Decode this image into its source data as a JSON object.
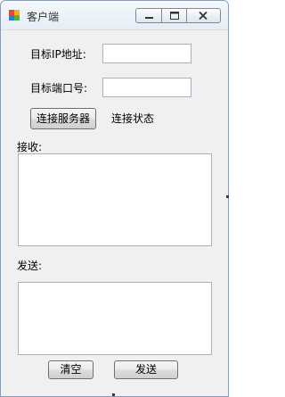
{
  "window": {
    "title": "客户端"
  },
  "form": {
    "target_ip_label": "目标IP地址:",
    "target_ip_value": "",
    "target_port_label": "目标端口号:",
    "target_port_value": "",
    "connect_button": "连接服务器",
    "connection_status": "连接状态",
    "receive_label": "接收:",
    "receive_value": "",
    "send_label": "发送:",
    "send_value": "",
    "clear_button": "清空",
    "send_button": "发送"
  },
  "icons": {
    "app": "app-windows-icon",
    "minimize": "minimize-icon",
    "maximize": "maximize-icon",
    "close": "close-icon"
  },
  "colors": {
    "window_background": "#f0f0f0",
    "field_border": "#a9b2bc"
  }
}
